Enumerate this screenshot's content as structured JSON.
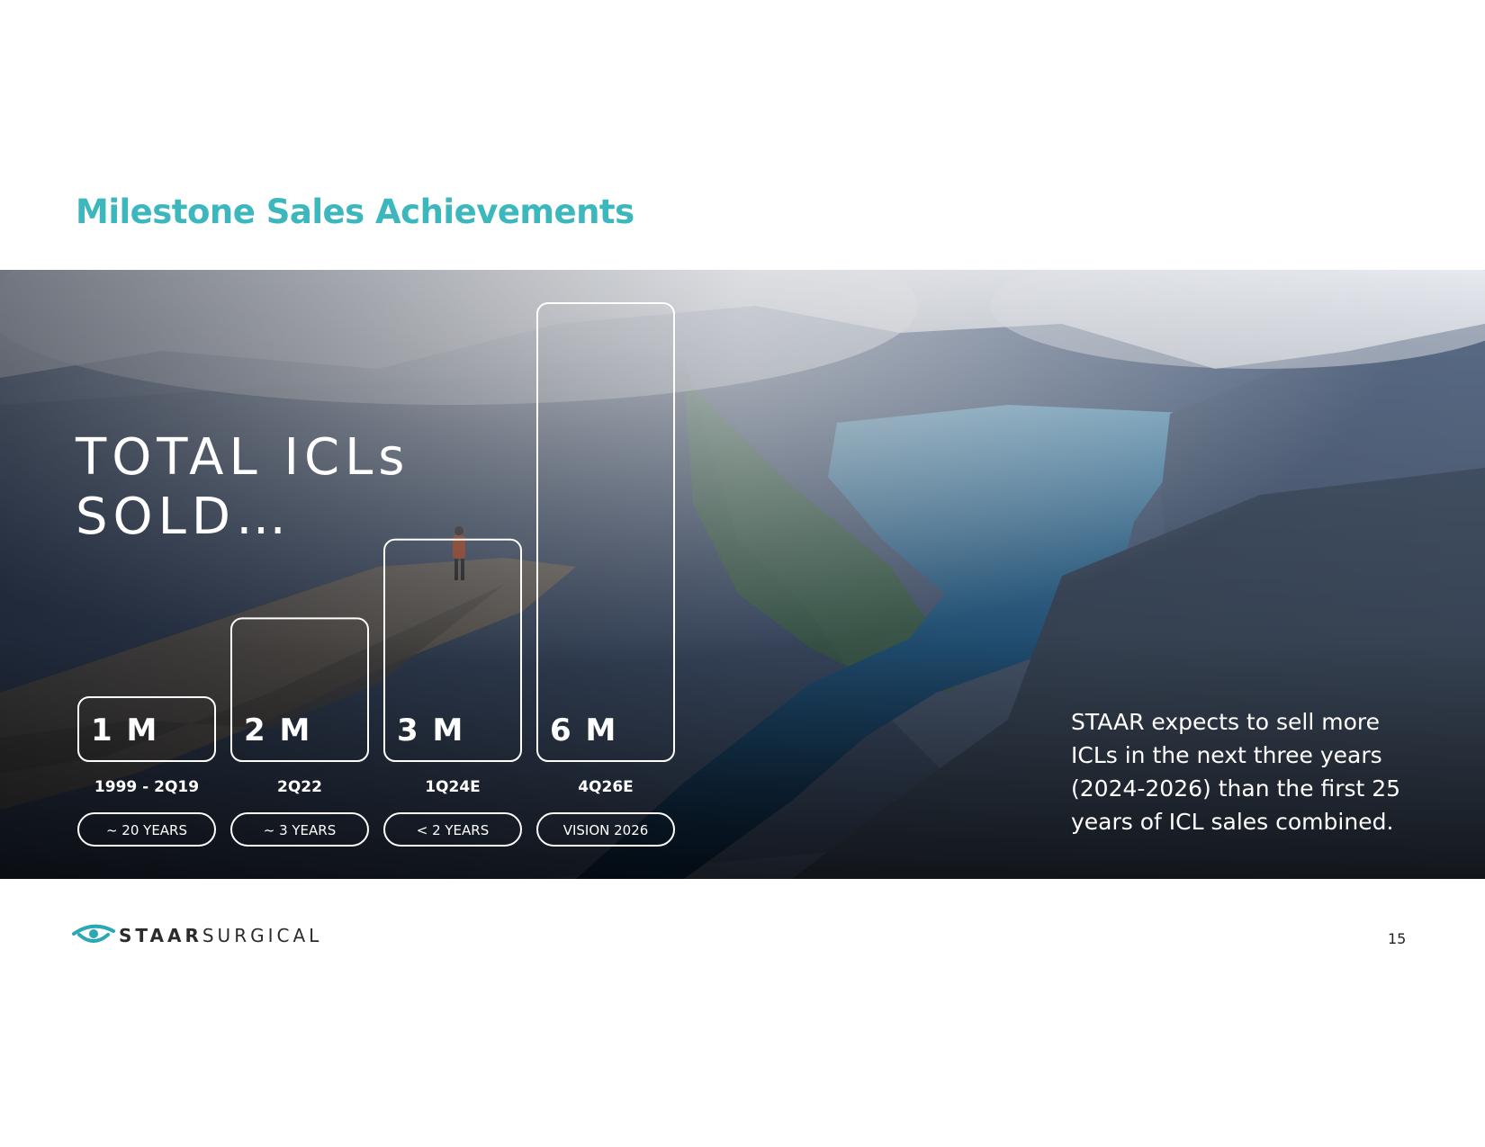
{
  "slide": {
    "title": "Milestone Sales Achievements",
    "page_number": "15"
  },
  "hero": {
    "headline_line1": "TOTAL ICLs",
    "headline_line2": "SOLD…",
    "side_note": "STAAR expects to sell more ICLs in the next three years (2024-2026) than the first 25 years of ICL sales combined."
  },
  "footer": {
    "logo_bold": "STAAR",
    "logo_light": "SURGICAL"
  },
  "colors": {
    "accent": "#3bb7bd",
    "text_on_image": "#ffffff"
  },
  "chart_data": {
    "type": "bar",
    "categories": [
      "1999 - 2Q19",
      "2Q22",
      "1Q24E",
      "4Q26E"
    ],
    "values": [
      1,
      2,
      3,
      6
    ],
    "value_labels": [
      "1 M",
      "2 M",
      "3 M",
      "6 M"
    ],
    "duration_labels": [
      "~ 20 YEARS",
      "~ 3 YEARS",
      "< 2 YEARS",
      "VISION 2026"
    ],
    "title": "",
    "xlabel": "",
    "ylabel": "",
    "ylim": [
      0,
      6
    ],
    "grid": false,
    "legend": "none"
  }
}
